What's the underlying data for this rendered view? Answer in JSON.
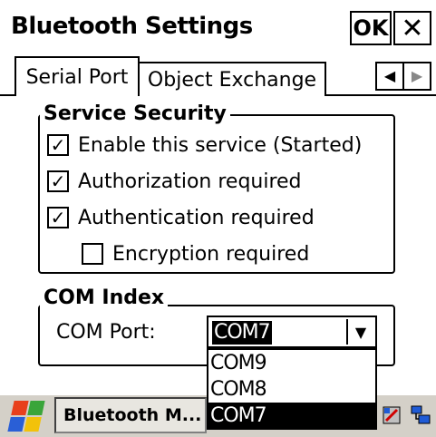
{
  "window": {
    "title": "Bluetooth Settings",
    "ok_label": "OK",
    "close_label": "✕"
  },
  "tabs": [
    {
      "label": "Serial Port",
      "active": true
    },
    {
      "label": "Object Exchange",
      "active": false
    }
  ],
  "tab_scroll": {
    "left": "◀",
    "right": "▶"
  },
  "security": {
    "legend": "Service Security",
    "options": [
      {
        "label": "Enable this service (Started)",
        "checked": true
      },
      {
        "label": "Authorization required",
        "checked": true
      },
      {
        "label": "Authentication required",
        "checked": true
      },
      {
        "label": "Encryption required",
        "checked": false
      }
    ]
  },
  "com_index": {
    "legend": "COM Index",
    "port_label": "COM Port:",
    "selected": "COM7",
    "options": [
      "COM9",
      "COM8",
      "COM7"
    ]
  },
  "taskbar": {
    "task_label": "Bluetooth M..."
  },
  "colors": {
    "taskbar": "#d4d0c8",
    "highlight": "#000000"
  }
}
